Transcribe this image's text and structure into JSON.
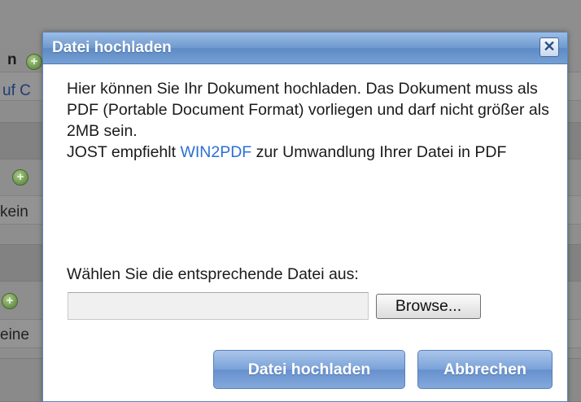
{
  "background": {
    "heading_fragment": "n",
    "link_fragment": "uf C",
    "row2_fragment": "kein",
    "row3_fragment": "eine"
  },
  "dialog": {
    "title": "Datei hochladen",
    "close_glyph": "✕",
    "paragraph_1": "Hier können Sie Ihr Dokument hochladen. Das Dokument muss als PDF (Portable Document Format) vorliegen und darf nicht größer als 2MB sein.",
    "paragraph_2_prefix": "JOST empfiehlt ",
    "paragraph_2_link": "WIN2PDF",
    "paragraph_2_suffix": " zur Umwandlung Ihrer Datei in PDF",
    "select_label": "Wählen Sie die entsprechende Datei aus:",
    "file_value": "",
    "browse_label": "Browse...",
    "upload_button": "Datei hochladen",
    "cancel_button": "Abbrechen"
  },
  "colors": {
    "titlebar": "#6e99cf",
    "link": "#2b6fd6",
    "button": "#7aa2d8",
    "overlay": "#8e8e8e"
  },
  "icons": {
    "add": "plus-circle-icon",
    "close": "close-icon"
  }
}
